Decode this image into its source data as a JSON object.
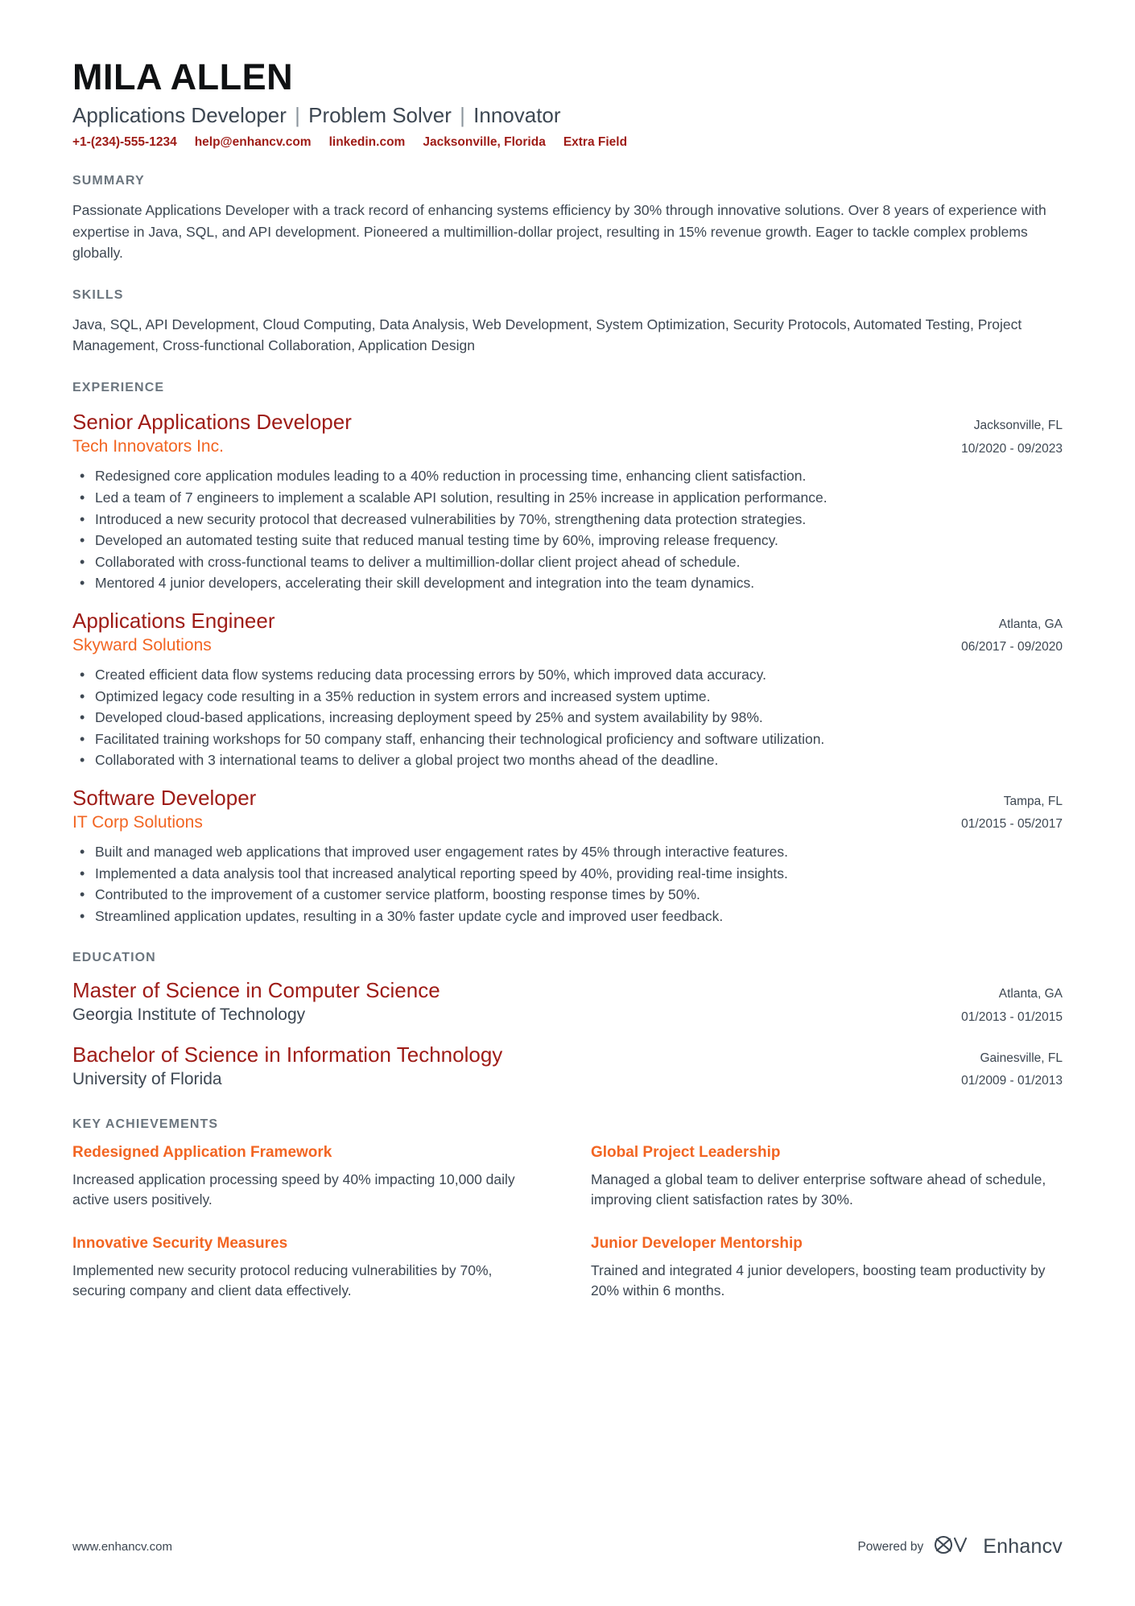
{
  "header": {
    "name": "MILA ALLEN",
    "headline_parts": [
      "Applications Developer",
      "Problem Solver",
      "Innovator"
    ],
    "headline_separator": "|",
    "contacts": [
      {
        "label": "+1-(234)-555-1234",
        "name": "phone"
      },
      {
        "label": "help@enhancv.com",
        "name": "email"
      },
      {
        "label": "linkedin.com",
        "name": "linkedin"
      },
      {
        "label": "Jacksonville, Florida",
        "name": "location"
      },
      {
        "label": "Extra Field",
        "name": "extra-field"
      }
    ]
  },
  "colors": {
    "accent_red": "#9e1b16",
    "accent_orange": "#f26522",
    "body_text": "#3d4752",
    "section_label": "#6b757e",
    "name_black": "#0f1113",
    "page_bg": "#ffffff",
    "canvas_bg": "#eceef0"
  },
  "summary": {
    "title": "SUMMARY",
    "text": "Passionate Applications Developer with a track record of enhancing systems efficiency by 30% through innovative solutions. Over 8 years of experience with expertise in Java, SQL, and API development. Pioneered a multimillion-dollar project, resulting in 15% revenue growth. Eager to tackle complex problems globally."
  },
  "skills": {
    "title": "SKILLS",
    "text": "Java, SQL, API Development, Cloud Computing, Data Analysis, Web Development, System Optimization, Security Protocols, Automated Testing, Project Management, Cross-functional Collaboration, Application Design"
  },
  "experience": {
    "title": "EXPERIENCE",
    "entries": [
      {
        "job_title": "Senior Applications Developer",
        "company": "Tech Innovators Inc.",
        "location": "Jacksonville, FL",
        "dates": "10/2020 - 09/2023",
        "bullets": [
          "Redesigned core application modules leading to a 40% reduction in processing time, enhancing client satisfaction.",
          "Led a team of 7 engineers to implement a scalable API solution, resulting in 25% increase in application performance.",
          "Introduced a new security protocol that decreased vulnerabilities by 70%, strengthening data protection strategies.",
          "Developed an automated testing suite that reduced manual testing time by 60%, improving release frequency.",
          "Collaborated with cross-functional teams to deliver a multimillion-dollar client project ahead of schedule.",
          "Mentored 4 junior developers, accelerating their skill development and integration into the team dynamics."
        ]
      },
      {
        "job_title": "Applications Engineer",
        "company": "Skyward Solutions",
        "location": "Atlanta, GA",
        "dates": "06/2017 - 09/2020",
        "bullets": [
          "Created efficient data flow systems reducing data processing errors by 50%, which improved data accuracy.",
          "Optimized legacy code resulting in a 35% reduction in system errors and increased system uptime.",
          "Developed cloud-based applications, increasing deployment speed by 25% and system availability by 98%.",
          "Facilitated training workshops for 50 company staff, enhancing their technological proficiency and software utilization.",
          "Collaborated with 3 international teams to deliver a global project two months ahead of the deadline."
        ]
      },
      {
        "job_title": "Software Developer",
        "company": "IT Corp Solutions",
        "location": "Tampa, FL",
        "dates": "01/2015 - 05/2017",
        "bullets": [
          "Built and managed web applications that improved user engagement rates by 45% through interactive features.",
          "Implemented a data analysis tool that increased analytical reporting speed by 40%, providing real-time insights.",
          "Contributed to the improvement of a customer service platform, boosting response times by 50%.",
          "Streamlined application updates, resulting in a 30% faster update cycle and improved user feedback."
        ]
      }
    ]
  },
  "education": {
    "title": "EDUCATION",
    "entries": [
      {
        "degree": "Master of Science in Computer Science",
        "school": "Georgia Institute of Technology",
        "location": "Atlanta, GA",
        "dates": "01/2013 - 01/2015"
      },
      {
        "degree": "Bachelor of Science in Information Technology",
        "school": "University of Florida",
        "location": "Gainesville, FL",
        "dates": "01/2009 - 01/2013"
      }
    ]
  },
  "achievements": {
    "title": "KEY ACHIEVEMENTS",
    "items": [
      {
        "title": "Redesigned Application Framework",
        "desc": "Increased application processing speed by 40% impacting 10,000 daily active users positively."
      },
      {
        "title": "Global Project Leadership",
        "desc": "Managed a global team to deliver enterprise software ahead of schedule, improving client satisfaction rates by 30%."
      },
      {
        "title": "Innovative Security Measures",
        "desc": "Implemented new security protocol reducing vulnerabilities by 70%, securing company and client data effectively."
      },
      {
        "title": "Junior Developer Mentorship",
        "desc": "Trained and integrated 4 junior developers, boosting team productivity by 20% within 6 months."
      }
    ]
  },
  "footer": {
    "url": "www.enhancv.com",
    "powered_by": "Powered by",
    "brand": "Enhancv",
    "brand_icon": "enhancv-infinity-logo"
  }
}
